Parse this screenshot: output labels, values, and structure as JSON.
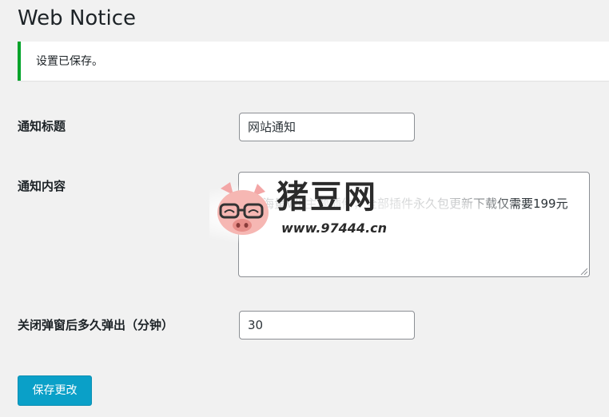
{
  "header": {
    "title": "Web Notice"
  },
  "notice": {
    "message": "设置已保存。"
  },
  "form": {
    "title_label": "通知标题",
    "title_value": "网站通知",
    "content_label": "通知内容",
    "content_value": "海量WP主题插件，全部插件永久包更新下载仅需要199元",
    "delay_label": "关闭弹窗后多久弹出（分钟）",
    "delay_value": "30"
  },
  "actions": {
    "save_label": "保存更改"
  },
  "watermark": {
    "brand": "猪豆网",
    "url": "www.97444.cn"
  },
  "colors": {
    "notice_border": "#00a32a",
    "button_bg": "#0aa0c8",
    "page_bg": "#f1f1f1"
  }
}
